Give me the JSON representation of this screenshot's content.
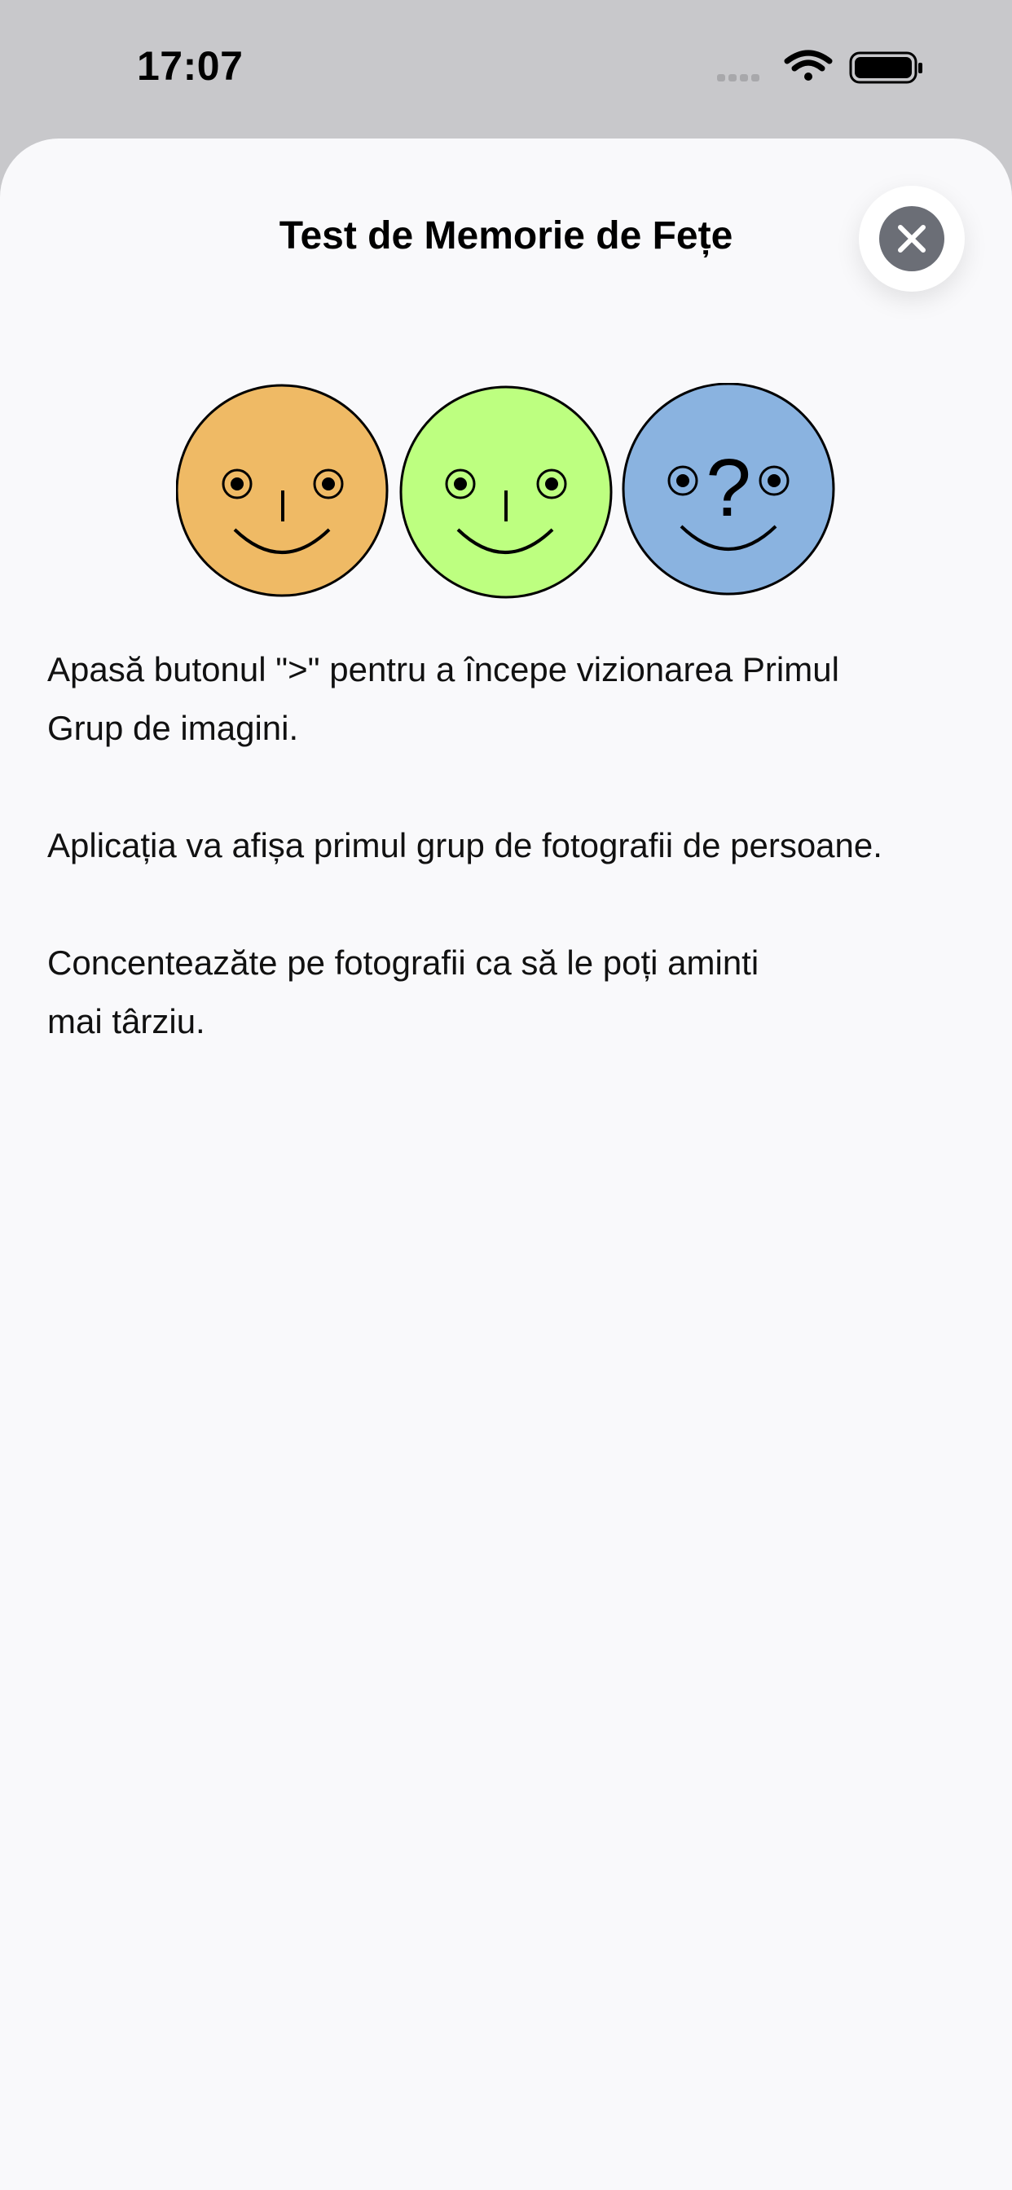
{
  "status_bar": {
    "time": "17:07"
  },
  "sheet": {
    "title": "Test de Memorie de Fețe",
    "close_icon": "xmark-circle-icon"
  },
  "illustration": {
    "faces": [
      {
        "name": "face-orange",
        "color": "#efba65"
      },
      {
        "name": "face-green",
        "color": "#bdff80"
      },
      {
        "name": "face-blue",
        "color": "#8ab3e0"
      }
    ],
    "question_mark": "?"
  },
  "instructions": {
    "p1_line1": "Apasă butonul \">\" pentru a începe vizionarea Primul",
    "p1_line2": "Grup de imagini.",
    "p2": "Aplicația va afișa primul grup de fotografii de persoane.",
    "p3_line1": "Concentează­te pe fotografii ca să le poți aminti",
    "p3_line2": "mai târziu."
  }
}
